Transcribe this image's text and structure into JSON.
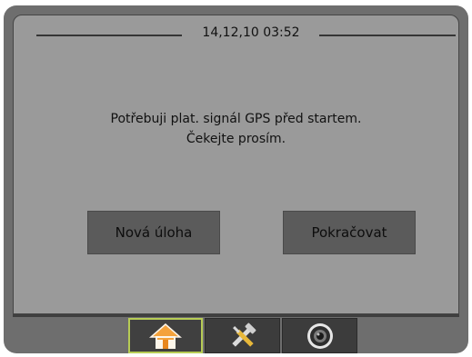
{
  "header": {
    "datetime": "14,12,10 03:52"
  },
  "message": {
    "line1": "Potřebuji plat. signál GPS před startem.",
    "line2": "Čekejte prosím."
  },
  "buttons": {
    "new_task": "Nová úloha",
    "continue": "Pokračovat"
  },
  "nav": {
    "tabs": [
      {
        "icon": "home-icon",
        "active": true
      },
      {
        "icon": "tools-icon",
        "active": false
      },
      {
        "icon": "camera-icon",
        "active": false
      }
    ],
    "active_border_color": "#b7cc55"
  },
  "colors": {
    "panel": "#9a9a9a",
    "frame": "#6e6e6e",
    "button": "#5b5b5b"
  }
}
